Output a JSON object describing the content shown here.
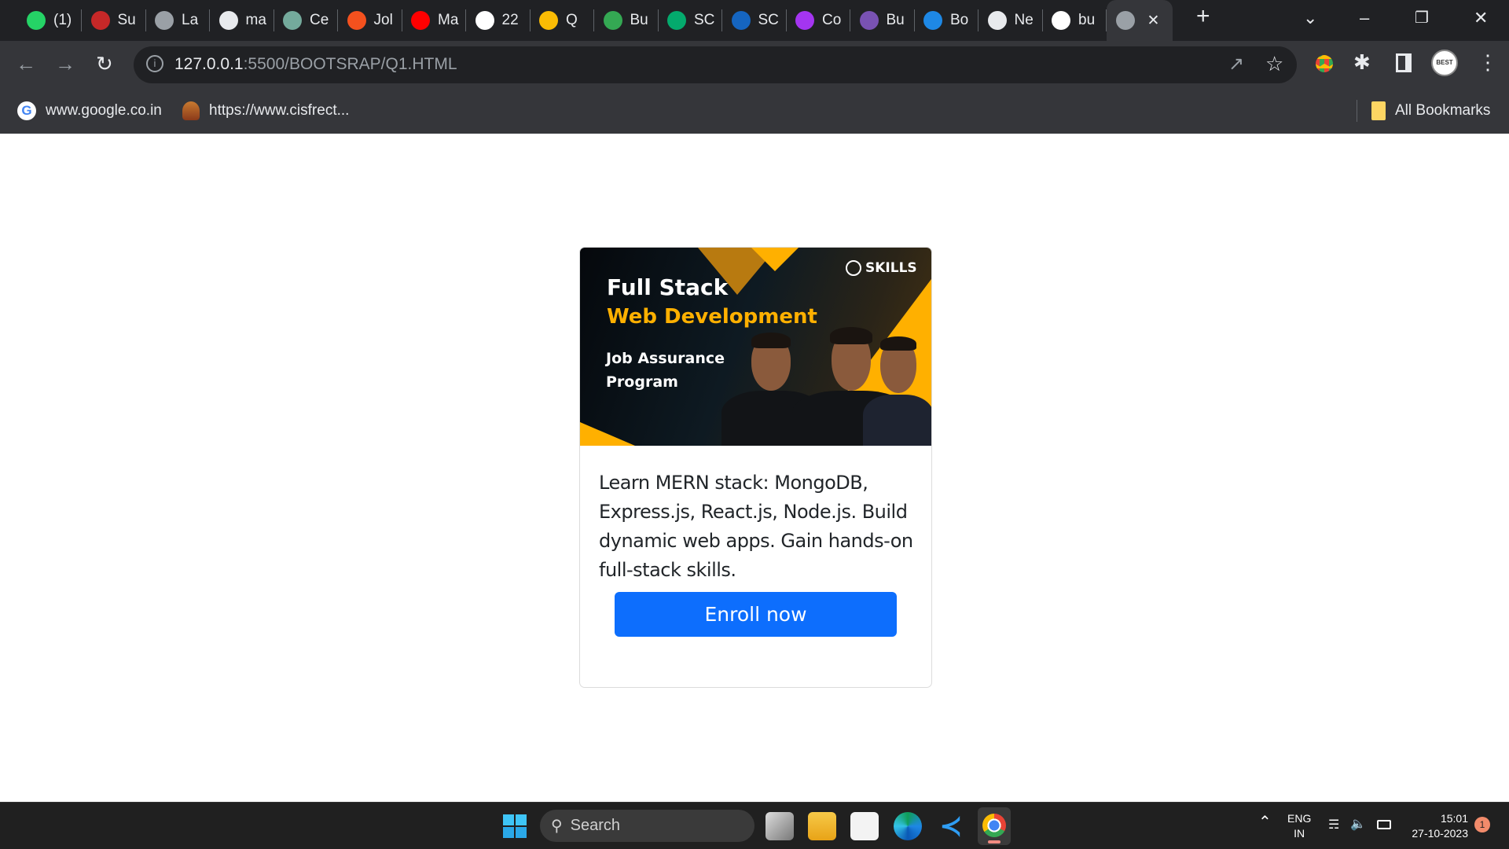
{
  "browser": {
    "tabs": [
      {
        "title": "(1)",
        "icon": "whatsapp-icon",
        "color": "#25d366"
      },
      {
        "title": "Su",
        "icon": "s-logo-icon",
        "color": "#c62828"
      },
      {
        "title": "La",
        "icon": "globe-icon",
        "color": "#9aa0a6"
      },
      {
        "title": "ma",
        "icon": "github-icon",
        "color": "#e8eaed"
      },
      {
        "title": "Ce",
        "icon": "chatgpt-icon",
        "color": "#74aa9c"
      },
      {
        "title": "Jol",
        "icon": "jolt-icon",
        "color": "#f4511e"
      },
      {
        "title": "Ma",
        "icon": "youtube-icon",
        "color": "#ff0000"
      },
      {
        "title": "22",
        "icon": "pw-icon",
        "color": "#ffffff"
      },
      {
        "title": "Q",
        "icon": "google-drive-icon",
        "color": "#fbbc04"
      },
      {
        "title": "Bu",
        "icon": "google-drive-icon",
        "color": "#34a853"
      },
      {
        "title": "SC",
        "icon": "w3schools-icon",
        "color": "#04aa6d"
      },
      {
        "title": "SC",
        "icon": "sql-icon",
        "color": "#1565c0"
      },
      {
        "title": "Co",
        "icon": "udemy-icon",
        "color": "#a435f0"
      },
      {
        "title": "Bu",
        "icon": "bootstrap-icon",
        "color": "#7952b3"
      },
      {
        "title": "Bo",
        "icon": "bolt-icon",
        "color": "#1e88e5"
      },
      {
        "title": "Ne",
        "icon": "chrome-icon",
        "color": "#e8eaed"
      },
      {
        "title": "bu",
        "icon": "google-icon",
        "color": "#ffffff"
      },
      {
        "title": "",
        "icon": "globe-icon",
        "color": "#9aa0a6",
        "active": true
      }
    ],
    "url_host": "127.0.0.1",
    "url_rest": ":5500/BOOTSRAP/Q1.HTML",
    "bookmarks": [
      {
        "label": "www.google.co.in",
        "icon": "google-icon"
      },
      {
        "label": "https://www.cisfrect...",
        "icon": "cisf-emblem-icon"
      }
    ],
    "all_bookmarks": "All Bookmarks",
    "profile_text": "BEST"
  },
  "card": {
    "banner": {
      "line1": "Full Stack",
      "line2": "Web Development",
      "line3": "Job Assurance",
      "line4": "Program",
      "brand": "SKILLS",
      "accent": "#ffb000"
    },
    "description": "Learn MERN stack: MongoDB, Express.js, React.js, Node.js. Build dynamic web apps. Gain hands-on full-stack skills.",
    "button": "Enroll now",
    "button_color": "#0d6efd"
  },
  "taskbar": {
    "search": "Search",
    "lang1": "ENG",
    "lang2": "IN",
    "time": "15:01",
    "date": "27-10-2023",
    "notifications": "1"
  }
}
